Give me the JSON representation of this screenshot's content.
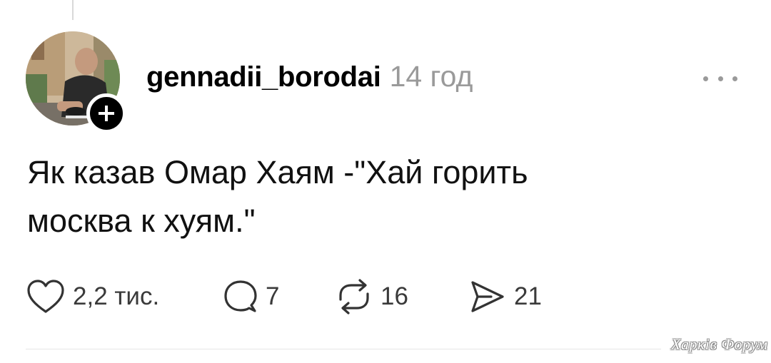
{
  "post": {
    "username": "gennadii_borodai",
    "time": "14 год",
    "text_line1": "Як казав Омар Хаям -\"Хай горить",
    "text_line2": "москва к хуям.\""
  },
  "actions": {
    "likes": "2,2 тис.",
    "comments": "7",
    "reposts": "16",
    "shares": "21"
  },
  "icons": {
    "follow": "plus-icon",
    "more": "more-horizontal-icon",
    "like": "heart-icon",
    "comment": "comment-icon",
    "repost": "repost-icon",
    "share": "share-icon"
  },
  "watermark": "Харків Форум"
}
